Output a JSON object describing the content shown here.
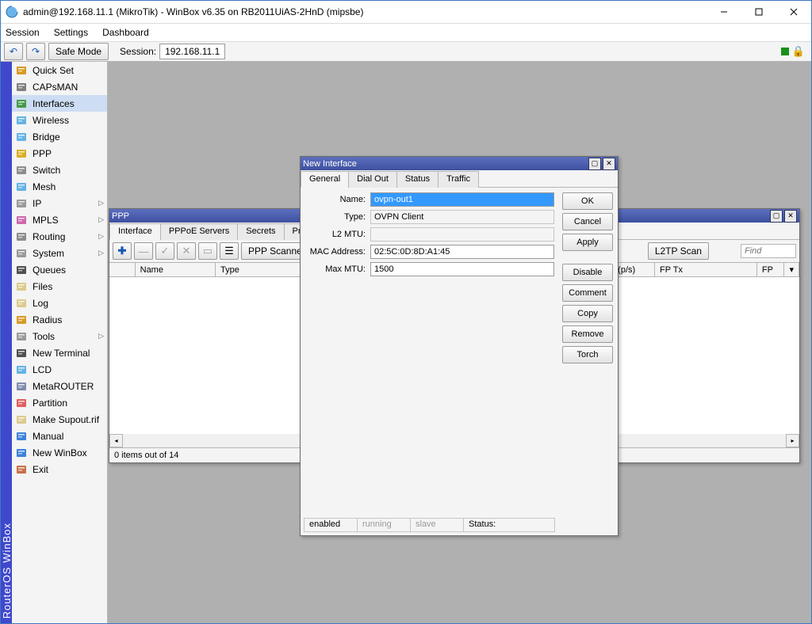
{
  "window": {
    "title": "admin@192.168.11.1 (MikroTik) - WinBox v6.35 on RB2011UiAS-2HnD (mipsbe)"
  },
  "menubar": [
    "Session",
    "Settings",
    "Dashboard"
  ],
  "toolbar": {
    "undo_glyph": "↶",
    "redo_glyph": "↷",
    "safe_mode": "Safe Mode",
    "session_label": "Session:",
    "session_value": "192.168.11.1"
  },
  "sidebar": {
    "brand": "RouterOS WinBox",
    "items": [
      {
        "label": "Quick Set",
        "icon": "wand"
      },
      {
        "label": "CAPsMAN",
        "icon": "antenna"
      },
      {
        "label": "Interfaces",
        "icon": "interfaces",
        "active": true
      },
      {
        "label": "Wireless",
        "icon": "wireless"
      },
      {
        "label": "Bridge",
        "icon": "bridge"
      },
      {
        "label": "PPP",
        "icon": "ppp"
      },
      {
        "label": "Switch",
        "icon": "switch"
      },
      {
        "label": "Mesh",
        "icon": "mesh"
      },
      {
        "label": "IP",
        "icon": "ip",
        "sub": true
      },
      {
        "label": "MPLS",
        "icon": "mpls",
        "sub": true
      },
      {
        "label": "Routing",
        "icon": "routing",
        "sub": true
      },
      {
        "label": "System",
        "icon": "system",
        "sub": true
      },
      {
        "label": "Queues",
        "icon": "queues"
      },
      {
        "label": "Files",
        "icon": "files"
      },
      {
        "label": "Log",
        "icon": "log"
      },
      {
        "label": "Radius",
        "icon": "radius"
      },
      {
        "label": "Tools",
        "icon": "tools",
        "sub": true
      },
      {
        "label": "New Terminal",
        "icon": "terminal"
      },
      {
        "label": "LCD",
        "icon": "lcd"
      },
      {
        "label": "MetaROUTER",
        "icon": "meta"
      },
      {
        "label": "Partition",
        "icon": "partition"
      },
      {
        "label": "Make Supout.rif",
        "icon": "supout"
      },
      {
        "label": "Manual",
        "icon": "manual"
      },
      {
        "label": "New WinBox",
        "icon": "newwin"
      },
      {
        "label": "Exit",
        "icon": "exit"
      }
    ]
  },
  "ppp": {
    "title": "PPP",
    "tabs": [
      "Interface",
      "PPPoE Servers",
      "Secrets",
      "Profiles"
    ],
    "active_tab": 0,
    "buttons": {
      "scan": "PPP Scanner",
      "l2tp": "L2TP Scan"
    },
    "find_placeholder": "Find",
    "cols": [
      "",
      "Name",
      "Type",
      "Packet (p/s)",
      "FP Tx",
      "FP"
    ],
    "footer": "0 items out of 14"
  },
  "newint": {
    "title": "New Interface",
    "tabs": [
      "General",
      "Dial Out",
      "Status",
      "Traffic"
    ],
    "active_tab": 0,
    "fields": {
      "name_label": "Name:",
      "name": "ovpn-out1",
      "type_label": "Type:",
      "type": "OVPN Client",
      "l2mtu_label": "L2 MTU:",
      "l2mtu": "",
      "mac_label": "MAC Address:",
      "mac": "02:5C:0D:8D:A1:45",
      "maxmtu_label": "Max MTU:",
      "maxmtu": "1500"
    },
    "side": [
      "OK",
      "Cancel",
      "Apply",
      "Disable",
      "Comment",
      "Copy",
      "Remove",
      "Torch"
    ],
    "status": {
      "enabled": "enabled",
      "running": "running",
      "slave": "slave",
      "status_label": "Status:"
    }
  }
}
